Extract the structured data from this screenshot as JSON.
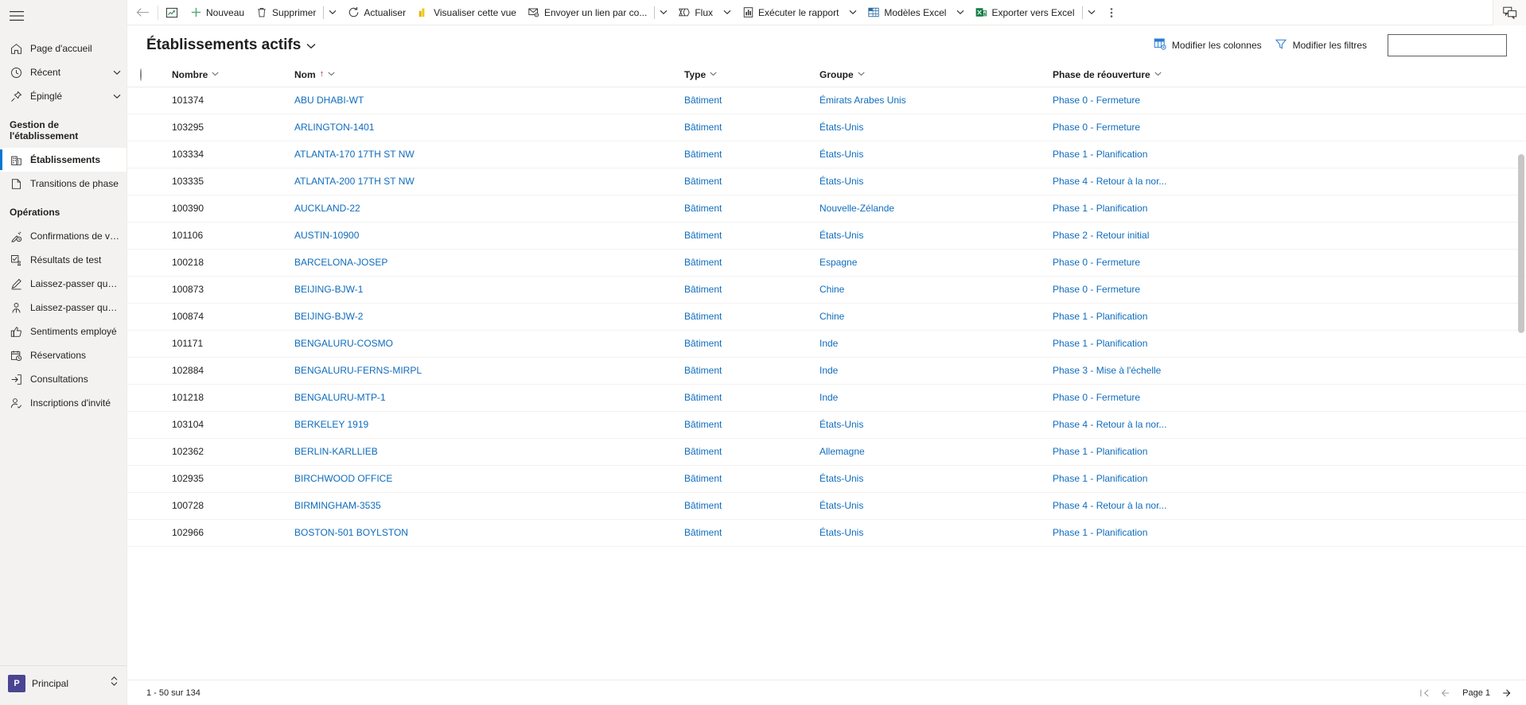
{
  "sidebar": {
    "hamburger_icon": "hamburger-menu-icon",
    "top_items": [
      {
        "label": "Page d'accueil",
        "icon": "home-icon",
        "chevron": false
      },
      {
        "label": "Récent",
        "icon": "clock-icon",
        "chevron": true
      },
      {
        "label": "Épinglé",
        "icon": "pin-icon",
        "chevron": true
      }
    ],
    "groups": [
      {
        "title": "Gestion de l'établissement",
        "items": [
          {
            "label": "Établissements",
            "icon": "building-icon",
            "selected": true
          },
          {
            "label": "Transitions de phase",
            "icon": "page-icon",
            "selected": false
          }
        ]
      },
      {
        "title": "Opérations",
        "items": [
          {
            "label": "Confirmations de va...",
            "icon": "syringe-clock-icon",
            "selected": false
          },
          {
            "label": "Résultats de test",
            "icon": "test-result-icon",
            "selected": false
          },
          {
            "label": "Laissez-passer quoti...",
            "icon": "pencil-icon",
            "selected": false
          },
          {
            "label": "Laissez-passer quoti...",
            "icon": "person-icon",
            "selected": false
          },
          {
            "label": "Sentiments employé",
            "icon": "thumbs-up-icon",
            "selected": false
          },
          {
            "label": "Réservations",
            "icon": "calendar-clock-icon",
            "selected": false
          },
          {
            "label": "Consultations",
            "icon": "sign-in-icon",
            "selected": false
          },
          {
            "label": "Inscriptions d'invité",
            "icon": "person-check-icon",
            "selected": false
          }
        ]
      }
    ],
    "area_switcher": {
      "badge": "P",
      "label": "Principal",
      "icon": "chevron-updown-icon"
    }
  },
  "commandbar": {
    "back_icon": "back-arrow-icon",
    "chart_icon": "show-chart-icon",
    "buttons": [
      {
        "label": "Nouveau",
        "icon": "plus-icon",
        "caret": false,
        "pipe": false
      },
      {
        "label": "Supprimer",
        "icon": "trash-icon",
        "caret": true,
        "pipe": true
      },
      {
        "label": "Actualiser",
        "icon": "refresh-icon",
        "caret": false,
        "pipe": false
      },
      {
        "label": "Visualiser cette vue",
        "icon": "powerbi-icon",
        "caret": false,
        "pipe": false
      },
      {
        "label": "Envoyer un lien par co...",
        "icon": "email-link-icon",
        "caret": true,
        "pipe": true
      },
      {
        "label": "Flux",
        "icon": "flow-icon",
        "caret": true,
        "pipe": false
      },
      {
        "label": "Exécuter le rapport",
        "icon": "report-icon",
        "caret": true,
        "pipe": false
      },
      {
        "label": "Modèles Excel",
        "icon": "excel-template-icon",
        "caret": true,
        "pipe": false
      },
      {
        "label": "Exporter vers Excel",
        "icon": "excel-export-icon",
        "caret": true,
        "pipe": true
      }
    ],
    "overflow_label": "⋮",
    "overflow_icon": "more-vertical-icon",
    "right_icon": "feedback-icon"
  },
  "viewheader": {
    "title": "Établissements actifs",
    "title_caret_icon": "chevron-down-icon",
    "edit_columns": {
      "label": "Modifier les colonnes",
      "icon": "edit-columns-icon"
    },
    "edit_filters": {
      "label": "Modifier les filtres",
      "icon": "filter-icon"
    },
    "search": {
      "value": "",
      "placeholder": ""
    }
  },
  "grid": {
    "select_all_icon": "select-all-circle-icon",
    "columns": [
      {
        "label": "Nombre",
        "sorted": false
      },
      {
        "label": "Nom",
        "sorted": true,
        "sort_dir": "↑"
      },
      {
        "label": "Type",
        "sorted": false
      },
      {
        "label": "Groupe",
        "sorted": false
      },
      {
        "label": "Phase de réouverture",
        "sorted": false
      }
    ],
    "rows": [
      {
        "nombre": "101374",
        "nom": "ABU DHABI-WT",
        "type": "Bâtiment",
        "groupe": "Émirats Arabes Unis",
        "phase": "Phase 0 - Fermeture"
      },
      {
        "nombre": "103295",
        "nom": "ARLINGTON-1401",
        "type": "Bâtiment",
        "groupe": "États-Unis",
        "phase": "Phase 0 - Fermeture"
      },
      {
        "nombre": "103334",
        "nom": "ATLANTA-170 17TH ST NW",
        "type": "Bâtiment",
        "groupe": "États-Unis",
        "phase": "Phase 1 - Planification"
      },
      {
        "nombre": "103335",
        "nom": "ATLANTA-200 17TH ST NW",
        "type": "Bâtiment",
        "groupe": "États-Unis",
        "phase": "Phase 4 - Retour à la nor..."
      },
      {
        "nombre": "100390",
        "nom": "AUCKLAND-22",
        "type": "Bâtiment",
        "groupe": "Nouvelle-Zélande",
        "phase": "Phase 1 - Planification"
      },
      {
        "nombre": "101106",
        "nom": "AUSTIN-10900",
        "type": "Bâtiment",
        "groupe": "États-Unis",
        "phase": "Phase 2 - Retour initial"
      },
      {
        "nombre": "100218",
        "nom": "BARCELONA-JOSEP",
        "type": "Bâtiment",
        "groupe": "Espagne",
        "phase": "Phase 0 - Fermeture"
      },
      {
        "nombre": "100873",
        "nom": "BEIJING-BJW-1",
        "type": "Bâtiment",
        "groupe": "Chine",
        "phase": "Phase 0 - Fermeture"
      },
      {
        "nombre": "100874",
        "nom": "BEIJING-BJW-2",
        "type": "Bâtiment",
        "groupe": "Chine",
        "phase": "Phase 1 - Planification"
      },
      {
        "nombre": "101171",
        "nom": "BENGALURU-COSMO",
        "type": "Bâtiment",
        "groupe": "Inde",
        "phase": "Phase 1 - Planification"
      },
      {
        "nombre": "102884",
        "nom": "BENGALURU-FERNS-MIRPL",
        "type": "Bâtiment",
        "groupe": "Inde",
        "phase": "Phase 3 - Mise à l'échelle"
      },
      {
        "nombre": "101218",
        "nom": "BENGALURU-MTP-1",
        "type": "Bâtiment",
        "groupe": "Inde",
        "phase": "Phase 0 - Fermeture"
      },
      {
        "nombre": "103104",
        "nom": "BERKELEY 1919",
        "type": "Bâtiment",
        "groupe": "États-Unis",
        "phase": "Phase 4 - Retour à la nor..."
      },
      {
        "nombre": "102362",
        "nom": "BERLIN-KARLLIEB",
        "type": "Bâtiment",
        "groupe": "Allemagne",
        "phase": "Phase 1 - Planification"
      },
      {
        "nombre": "102935",
        "nom": "BIRCHWOOD OFFICE",
        "type": "Bâtiment",
        "groupe": "États-Unis",
        "phase": "Phase 1 - Planification"
      },
      {
        "nombre": "100728",
        "nom": "BIRMINGHAM-3535",
        "type": "Bâtiment",
        "groupe": "États-Unis",
        "phase": "Phase 4 - Retour à la nor..."
      },
      {
        "nombre": "102966",
        "nom": "BOSTON-501 BOYLSTON",
        "type": "Bâtiment",
        "groupe": "États-Unis",
        "phase": "Phase 1 - Planification"
      }
    ]
  },
  "footer": {
    "record_count": "1 - 50 sur 134",
    "first_page_icon": "first-page-icon",
    "prev_page_icon": "prev-page-icon",
    "page_label": "Page 1",
    "next_page_icon": "next-page-icon"
  },
  "colors": {
    "accent": "#0078d4",
    "link": "#0f6cbd",
    "sidebar_bg": "#f3f2f1",
    "sort_arrow": "#a4262c",
    "excel_green": "#107c41",
    "powerbi_yellow": "#e8b100",
    "area_badge": "#4a4593"
  }
}
